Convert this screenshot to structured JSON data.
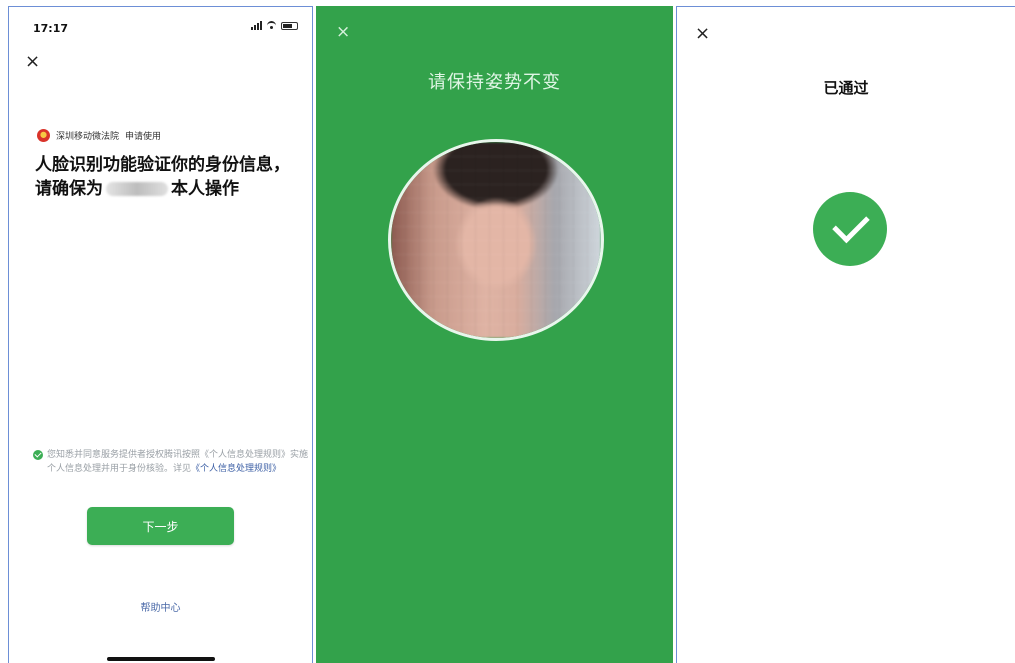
{
  "panel1": {
    "status": {
      "time": "17:17"
    },
    "close": "×",
    "requester": {
      "app": "深圳移动微法院",
      "action": "申请使用"
    },
    "headline": {
      "line1": "人脸识别功能验证你的身份信息，请确保为",
      "line2": "本人操作"
    },
    "consent": {
      "text": "您知悉并同意服务提供者授权腾讯按照《个人信息处理规则》实施个人信息处理并用于身份核验。详见",
      "link": "《个人信息处理规则》"
    },
    "next_button": "下一步",
    "help": "帮助中心"
  },
  "panel2": {
    "close": "×",
    "instruction": "请保持姿势不变"
  },
  "panel3": {
    "close": "×",
    "status": "已通过"
  },
  "colors": {
    "accent_green": "#3cae55",
    "scan_bg": "#33a24b",
    "link": "#3c5fa5"
  }
}
